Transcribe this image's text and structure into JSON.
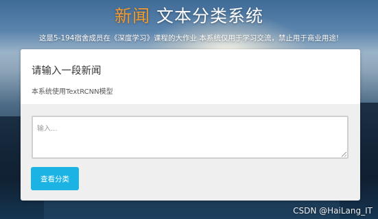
{
  "header": {
    "title_accent": "新闻",
    "title_rest": " 文本分类系统",
    "subtitle": "这是5-194宿舍成员在《深度学习》课程的大作业 本系统仅用于学习交流，禁止用于商业用途!"
  },
  "card": {
    "title": "请输入一段新闻",
    "hint": "本系统使用TextRCNN模型",
    "input_placeholder": "输入...",
    "input_value": "",
    "button_label": "查看分类"
  },
  "watermark": "CSDN @HaiLang_IT",
  "colors": {
    "accent": "#f29a2e",
    "button": "#1bb3e3"
  }
}
